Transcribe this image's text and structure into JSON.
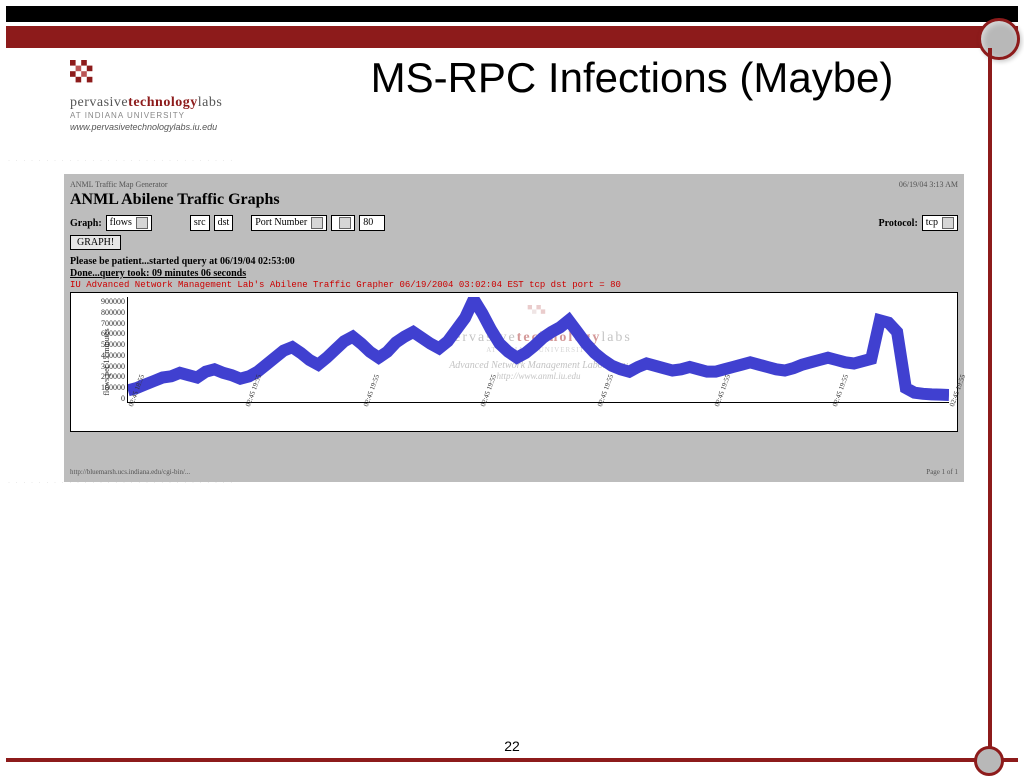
{
  "slide": {
    "title": "MS-RPC Infections (Maybe)",
    "page_number": "22"
  },
  "logo": {
    "brand_pervasive": "pervasive",
    "brand_technology": "technology",
    "brand_labs": "labs",
    "sub": "AT INDIANA UNIVERSITY",
    "url": "www.pervasivetechnologylabs.iu.edu"
  },
  "panel": {
    "top_left": "ANML Traffic Map Generator",
    "top_right": "06/19/04 3:13 AM",
    "heading": "ANML Abilene Traffic Graphs",
    "controls": {
      "graph_label": "Graph:",
      "graph_value": "flows",
      "srcdst": {
        "src": "src",
        "dst": "dst"
      },
      "port_label": "Port Number",
      "port_value": "80",
      "protocol_label": "Protocol:",
      "protocol_value": "tcp",
      "button": "GRAPH!"
    },
    "status1": "Please be patient...started query at 06/19/04 02:53:00",
    "status2": "Done...query took: 09 minutes 06 seconds",
    "red_caption": "IU Advanced Network Management Lab's Abilene Traffic Grapher 06/19/2004 03:02:04 EST tcp dst port = 80",
    "watermark": {
      "line1a": "pervasive",
      "line1b": "technology",
      "line1c": "labs",
      "line2": "AT INDIANA UNIVERSITY",
      "sub1": "Advanced Network Management Laboratory",
      "sub2": "http://www.anml.iu.edu"
    },
    "footer_left": "http://bluemarsh.ucs.indiana.edu/cgi-bin/...",
    "footer_right": "Page 1 of 1"
  },
  "chart_data": {
    "type": "line",
    "title": "",
    "xlabel": "",
    "ylabel": "flows per 15 minutes",
    "ylim": [
      0,
      900000
    ],
    "yticks": [
      "0",
      "100000",
      "200000",
      "300000",
      "400000",
      "500000",
      "600000",
      "700000",
      "800000",
      "900000"
    ],
    "xticks": [
      "02:45 18:55",
      "02:45 19:55",
      "02:45 19:55",
      "02:45 19:55",
      "02:45 19:55",
      "02:45 19:55",
      "02:45 19:55",
      "02:45 19:55"
    ],
    "series": [
      {
        "name": "flows",
        "color": "#4040d0",
        "values": [
          100000,
          120000,
          150000,
          180000,
          210000,
          220000,
          250000,
          230000,
          210000,
          260000,
          280000,
          250000,
          230000,
          200000,
          220000,
          260000,
          320000,
          380000,
          440000,
          470000,
          420000,
          360000,
          320000,
          380000,
          450000,
          520000,
          560000,
          500000,
          430000,
          380000,
          430000,
          510000,
          560000,
          600000,
          550000,
          500000,
          460000,
          520000,
          620000,
          720000,
          880000,
          760000,
          620000,
          500000,
          430000,
          380000,
          420000,
          480000,
          550000,
          600000,
          640000,
          700000,
          600000,
          500000,
          420000,
          360000,
          310000,
          280000,
          260000,
          300000,
          330000,
          310000,
          290000,
          270000,
          280000,
          300000,
          280000,
          260000,
          260000,
          280000,
          300000,
          320000,
          340000,
          320000,
          300000,
          280000,
          270000,
          290000,
          320000,
          340000,
          360000,
          380000,
          360000,
          340000,
          330000,
          350000,
          370000,
          700000,
          680000,
          600000,
          120000,
          80000,
          70000,
          65000,
          63000,
          60000
        ]
      }
    ]
  }
}
